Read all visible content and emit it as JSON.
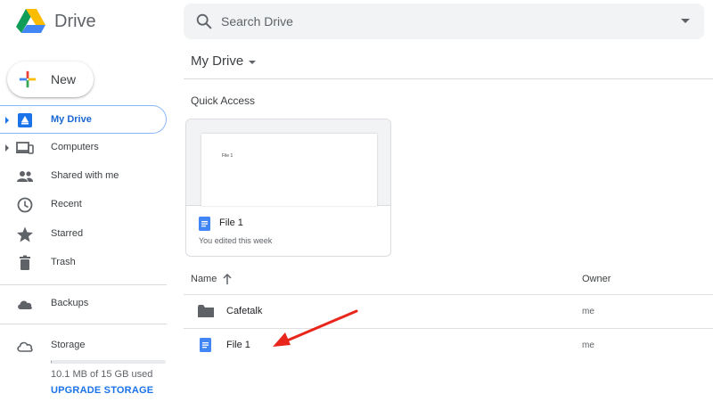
{
  "app": {
    "name": "Drive"
  },
  "search": {
    "placeholder": "Search Drive"
  },
  "new_button": {
    "label": "New"
  },
  "sidebar": {
    "items": [
      {
        "label": "My Drive",
        "icon": "my-drive-icon",
        "active": true
      },
      {
        "label": "Computers",
        "icon": "computers-icon"
      },
      {
        "label": "Shared with me",
        "icon": "shared-icon"
      },
      {
        "label": "Recent",
        "icon": "clock-icon"
      },
      {
        "label": "Starred",
        "icon": "star-icon"
      },
      {
        "label": "Trash",
        "icon": "trash-icon"
      }
    ],
    "backups": {
      "label": "Backups",
      "icon": "cloud-filled-icon"
    },
    "storage": {
      "label": "Storage",
      "icon": "cloud-outline-icon",
      "used_text": "10.1 MB of 15 GB used",
      "used_fraction": 0.001,
      "upgrade_label": "UPGRADE STORAGE"
    }
  },
  "main": {
    "title": "My Drive",
    "quick_access": {
      "title": "Quick Access",
      "cards": [
        {
          "name": "File 1",
          "subtitle": "You edited this week",
          "preview_text": "File 1",
          "icon": "docs-icon"
        }
      ]
    },
    "table": {
      "columns": {
        "name": "Name",
        "owner": "Owner"
      },
      "rows": [
        {
          "name": "Cafetalk",
          "owner": "me",
          "icon": "folder-icon"
        },
        {
          "name": "File 1",
          "owner": "me",
          "icon": "docs-icon"
        }
      ]
    }
  },
  "colors": {
    "accent": "#1a73e8",
    "docs_blue": "#4285f4",
    "annotation_arrow": "#e8261b"
  }
}
